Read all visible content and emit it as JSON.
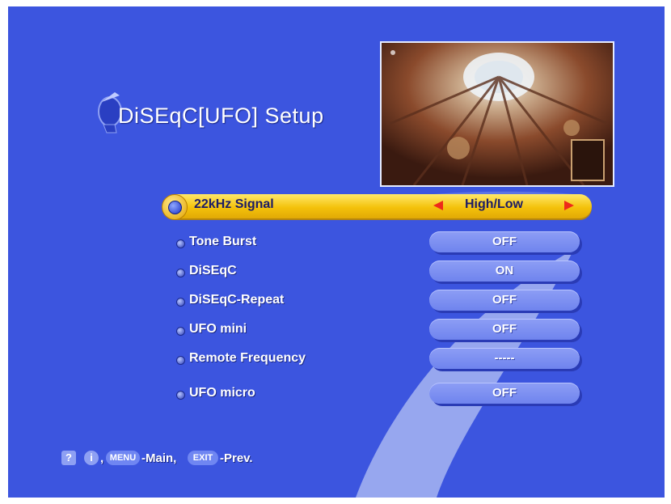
{
  "page_title": "DiSEqC[UFO] Setup",
  "menu": {
    "selected": {
      "label": "22kHz Signal",
      "value": "High/Low"
    },
    "rows": [
      {
        "label": "Tone Burst",
        "value": "OFF"
      },
      {
        "label": "DiSEqC",
        "value": "ON"
      },
      {
        "label": "DiSEqC-Repeat",
        "value": "OFF"
      },
      {
        "label": "UFO mini",
        "value": "OFF"
      },
      {
        "label": "Remote Frequency",
        "value": "-----"
      },
      {
        "label": "UFO micro",
        "value": "OFF"
      }
    ]
  },
  "footer": {
    "help_key": "?",
    "info_key": "i",
    "separator": ",",
    "menu_key": "MENU",
    "menu_text": "-Main,",
    "exit_key": "EXIT",
    "exit_text": "-Prev."
  },
  "icons": [
    "satellite-dish-icon",
    "help-icon",
    "info-icon"
  ],
  "colors": {
    "background": "#3c55df",
    "selected_bar": "#f4c20b",
    "arrow": "#ee2a1a",
    "value_pill": "#7f92f1"
  }
}
